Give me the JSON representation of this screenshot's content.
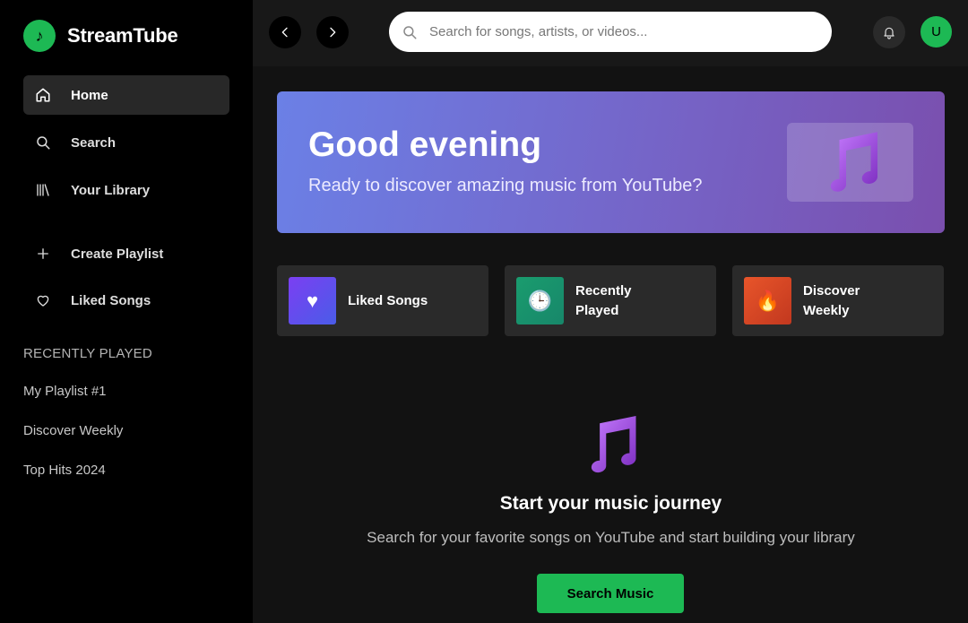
{
  "brand": {
    "name": "StreamTube",
    "logo_glyph": "♪",
    "accent": "#1db954"
  },
  "sidebar": {
    "nav": [
      {
        "label": "Home",
        "icon": "home-icon",
        "active": true
      },
      {
        "label": "Search",
        "icon": "search-icon",
        "active": false
      },
      {
        "label": "Your Library",
        "icon": "library-icon",
        "active": false
      }
    ],
    "actions": [
      {
        "label": "Create Playlist",
        "icon": "plus-icon"
      },
      {
        "label": "Liked Songs",
        "icon": "heart-icon"
      }
    ],
    "recent_title": "RECENTLY PLAYED",
    "recent": [
      "My Playlist #1",
      "Discover Weekly",
      "Top Hits 2024"
    ]
  },
  "topbar": {
    "search_placeholder": "Search for songs, artists, or videos...",
    "avatar_initial": "U"
  },
  "hero": {
    "title": "Good evening",
    "subtitle": "Ready to discover amazing music from YouTube?",
    "art_icon": "music-notes-icon"
  },
  "quick_access": [
    {
      "label": "Liked Songs",
      "icon": "heart-icon",
      "glyph": "♥",
      "colors": [
        "#7b3ff2",
        "#4a5ce8"
      ]
    },
    {
      "label": "Recently Played",
      "icon": "clock-icon",
      "glyph": "🕒",
      "colors": [
        "#1a9c6e",
        "#17876a"
      ]
    },
    {
      "label": "Discover Weekly",
      "icon": "fire-icon",
      "glyph": "🔥",
      "colors": [
        "#e8552a",
        "#c2381f"
      ]
    }
  ],
  "empty_state": {
    "title": "Start your music journey",
    "subtitle": "Search for your favorite songs on YouTube and start building your library",
    "button_label": "Search Music"
  }
}
